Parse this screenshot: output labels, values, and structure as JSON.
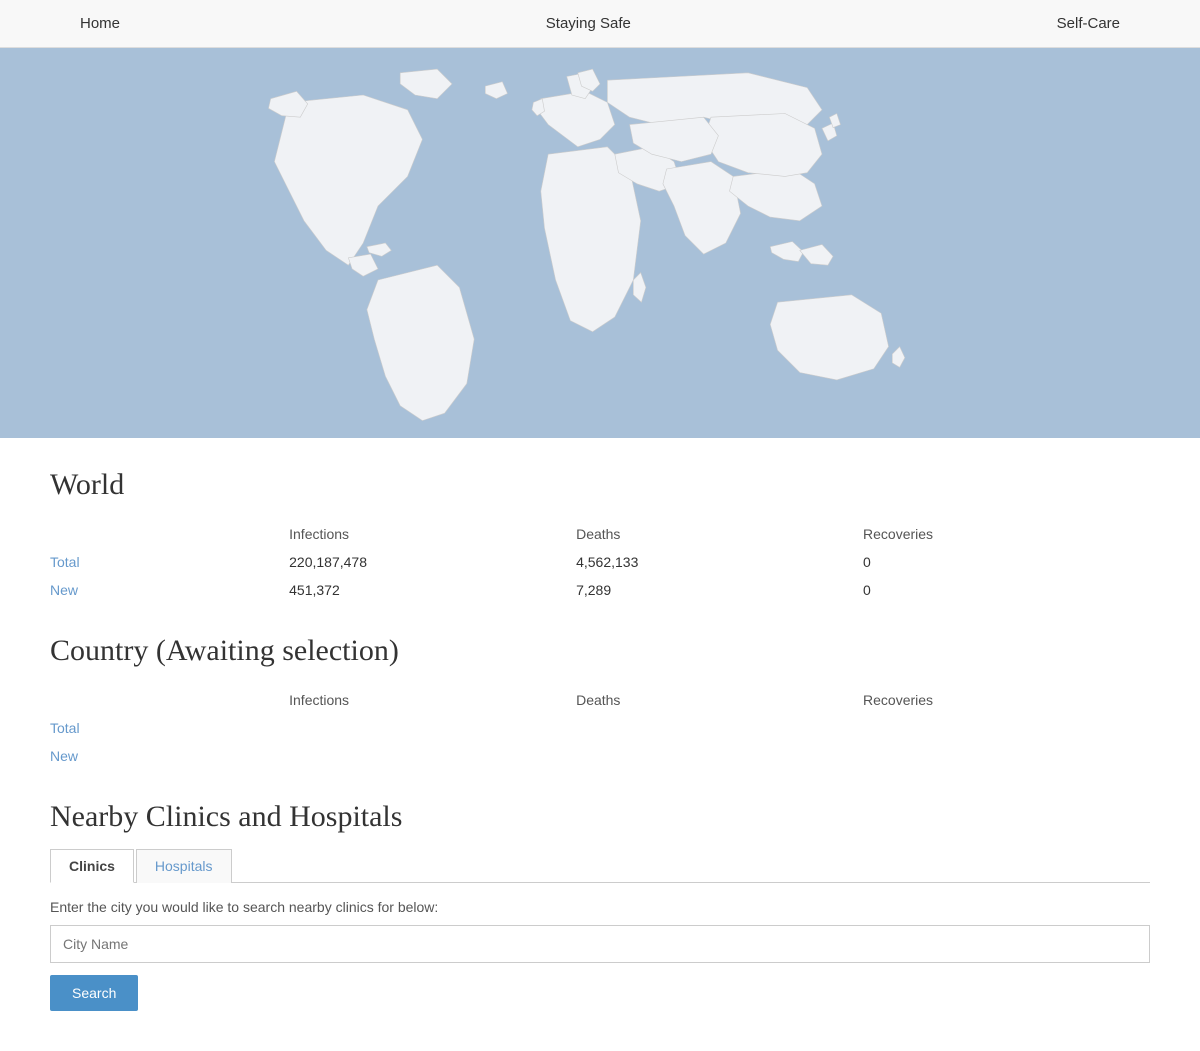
{
  "nav": {
    "home": "Home",
    "staying_safe": "Staying Safe",
    "self_care": "Self-Care"
  },
  "world": {
    "title": "World",
    "columns": {
      "infections": "Infections",
      "deaths": "Deaths",
      "recoveries": "Recoveries"
    },
    "rows": {
      "total_label": "Total",
      "new_label": "New",
      "total_infections": "220,187,478",
      "total_deaths": "4,562,133",
      "total_recoveries": "0",
      "new_infections": "451,372",
      "new_deaths": "7,289",
      "new_recoveries": "0"
    }
  },
  "country": {
    "title": "Country (Awaiting selection)",
    "columns": {
      "infections": "Infections",
      "deaths": "Deaths",
      "recoveries": "Recoveries"
    },
    "rows": {
      "total_label": "Total",
      "new_label": "New",
      "total_infections": "",
      "total_deaths": "",
      "total_recoveries": "",
      "new_infections": "",
      "new_deaths": "",
      "new_recoveries": ""
    }
  },
  "nearby": {
    "title": "Nearby Clinics and Hospitals",
    "tabs": [
      "Clinics",
      "Hospitals"
    ],
    "active_tab": 0,
    "search_label": "Enter the city you would like to search nearby clinics for below:",
    "city_placeholder": "City Name",
    "search_button": "Search"
  }
}
